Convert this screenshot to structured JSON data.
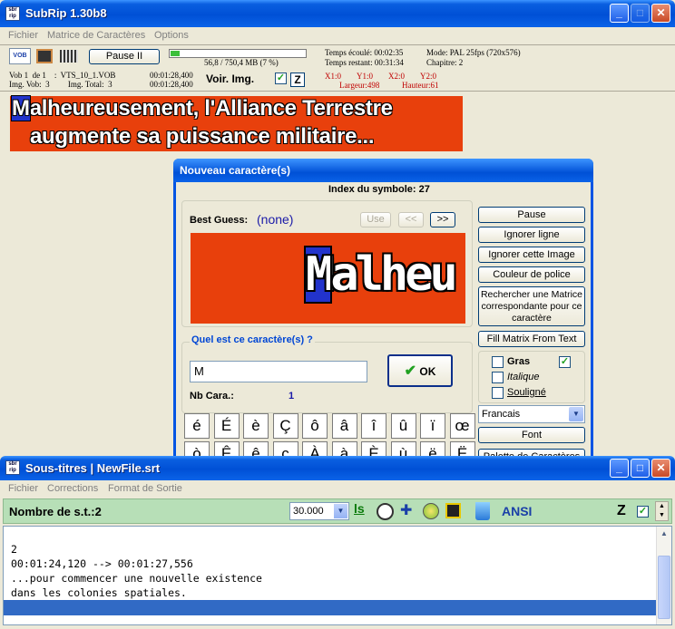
{
  "main_window": {
    "title": "SubRip 1.30b8",
    "menu": [
      "Fichier",
      "Matrice de Caractères",
      "Options"
    ]
  },
  "info": {
    "pause_label": "Pause  II",
    "progress_text": "56,8 / 750,4 MB (7 %)",
    "progress": 0.07,
    "temps_ecoule": "Temps écoulé: 00:02:35",
    "temps_restant": "Temps restant: 00:31:34",
    "mode": "Mode:  PAL 25fps (720x576)",
    "chapitre": "Chapitre:  2",
    "vob_line": "Vob 1  de 1    :  VTS_10_1.VOB",
    "img_vob_line": "Img. Vob:  3         Img. Total:  3",
    "time1": "00:01:28,400",
    "time2": "00:01:28,400",
    "voir_img": "Voir. Img.",
    "x1": "X1:0",
    "y1": "Y1:0",
    "x2": "X2:0",
    "y2": "Y2:0",
    "largeur": "Largeur:498",
    "hauteur": "Hauteur:61"
  },
  "subtitle_image": {
    "line1_first": "M",
    "line1_rest": "alheureusement, l'Alliance Terrestre",
    "line2": "augmente sa puissance militaire..."
  },
  "dialog": {
    "title": "Nouveau caractère(s)",
    "index": "Index du symbole: 27",
    "best_guess_label": "Best Guess:",
    "best_guess_value": "(none)",
    "use": "Use",
    "prev": "<<",
    "next": ">>",
    "preview_first": "M",
    "preview_rest": "alheu",
    "question": "Quel est ce caractère(s) ?",
    "input_value": "M",
    "ok": "OK",
    "nb_cara_label": "Nb Cara.:",
    "nb_cara_value": "1",
    "buttons": [
      "Pause",
      "Ignorer ligne",
      "Ignorer cette Image",
      "Couleur de police",
      "Rechercher une Matrice correspondante pour ce caractère",
      "Fill Matrix From Text"
    ],
    "gras": "Gras",
    "italique": "Italique",
    "souligne": "Souligné",
    "language": "Francais",
    "font_btn": "Font",
    "palette_btn": "Palette de Caractères",
    "chars_row1": [
      "é",
      "É",
      "è",
      "Ç",
      "ô",
      "â",
      "î",
      "û",
      "ï",
      "œ"
    ],
    "chars_row2": [
      "ò",
      "Ê",
      "ê",
      "ç",
      "À",
      "à",
      "È",
      "ù",
      "ë",
      "Ë"
    ]
  },
  "subs_window": {
    "title": "Sous-titres  |  NewFile.srt",
    "menu": [
      "Fichier",
      "Corrections",
      "Format de Sortie"
    ],
    "nombre": "Nombre de s.t.:2",
    "fps": "30.000",
    "ansi": "ANSI",
    "z": "Z",
    "lines": [
      "2",
      "00:01:24,120 --> 00:01:27,556",
      "...pour commencer une nouvelle existence",
      "dans les colonies spatiales."
    ]
  },
  "colors": {
    "title_blue": "#0054e3",
    "accent_orange": "#e8400c",
    "green_bar": "#b7dfb7"
  }
}
